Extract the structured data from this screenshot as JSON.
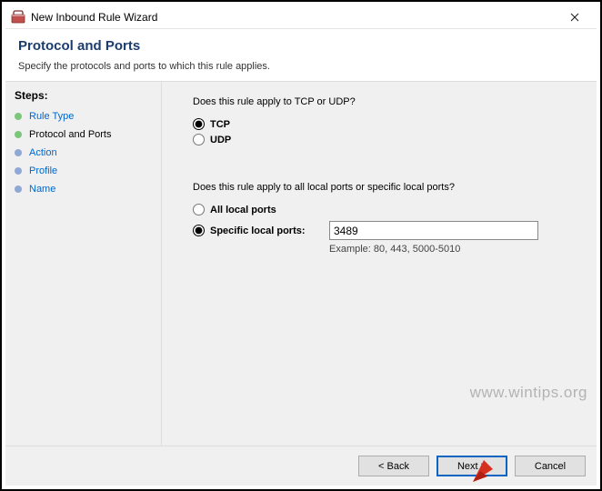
{
  "window": {
    "title": "New Inbound Rule Wizard"
  },
  "header": {
    "heading": "Protocol and Ports",
    "subtitle": "Specify the protocols and ports to which this rule applies."
  },
  "sidebar": {
    "steps_label": "Steps:",
    "items": [
      {
        "label": "Rule Type",
        "state": "done"
      },
      {
        "label": "Protocol and Ports",
        "state": "current"
      },
      {
        "label": "Action",
        "state": "todo"
      },
      {
        "label": "Profile",
        "state": "todo"
      },
      {
        "label": "Name",
        "state": "todo"
      }
    ]
  },
  "main": {
    "protocol_question": "Does this rule apply to TCP or UDP?",
    "protocol": {
      "tcp_label": "TCP",
      "udp_label": "UDP",
      "selected": "tcp"
    },
    "ports_question": "Does this rule apply to all local ports or specific local ports?",
    "ports": {
      "all_label": "All local ports",
      "specific_label": "Specific local ports:",
      "selected": "specific",
      "value": "3489",
      "example": "Example: 80, 443, 5000-5010"
    }
  },
  "footer": {
    "back": "< Back",
    "next": "Next >",
    "cancel": "Cancel"
  },
  "watermark": "www.wintips.org"
}
